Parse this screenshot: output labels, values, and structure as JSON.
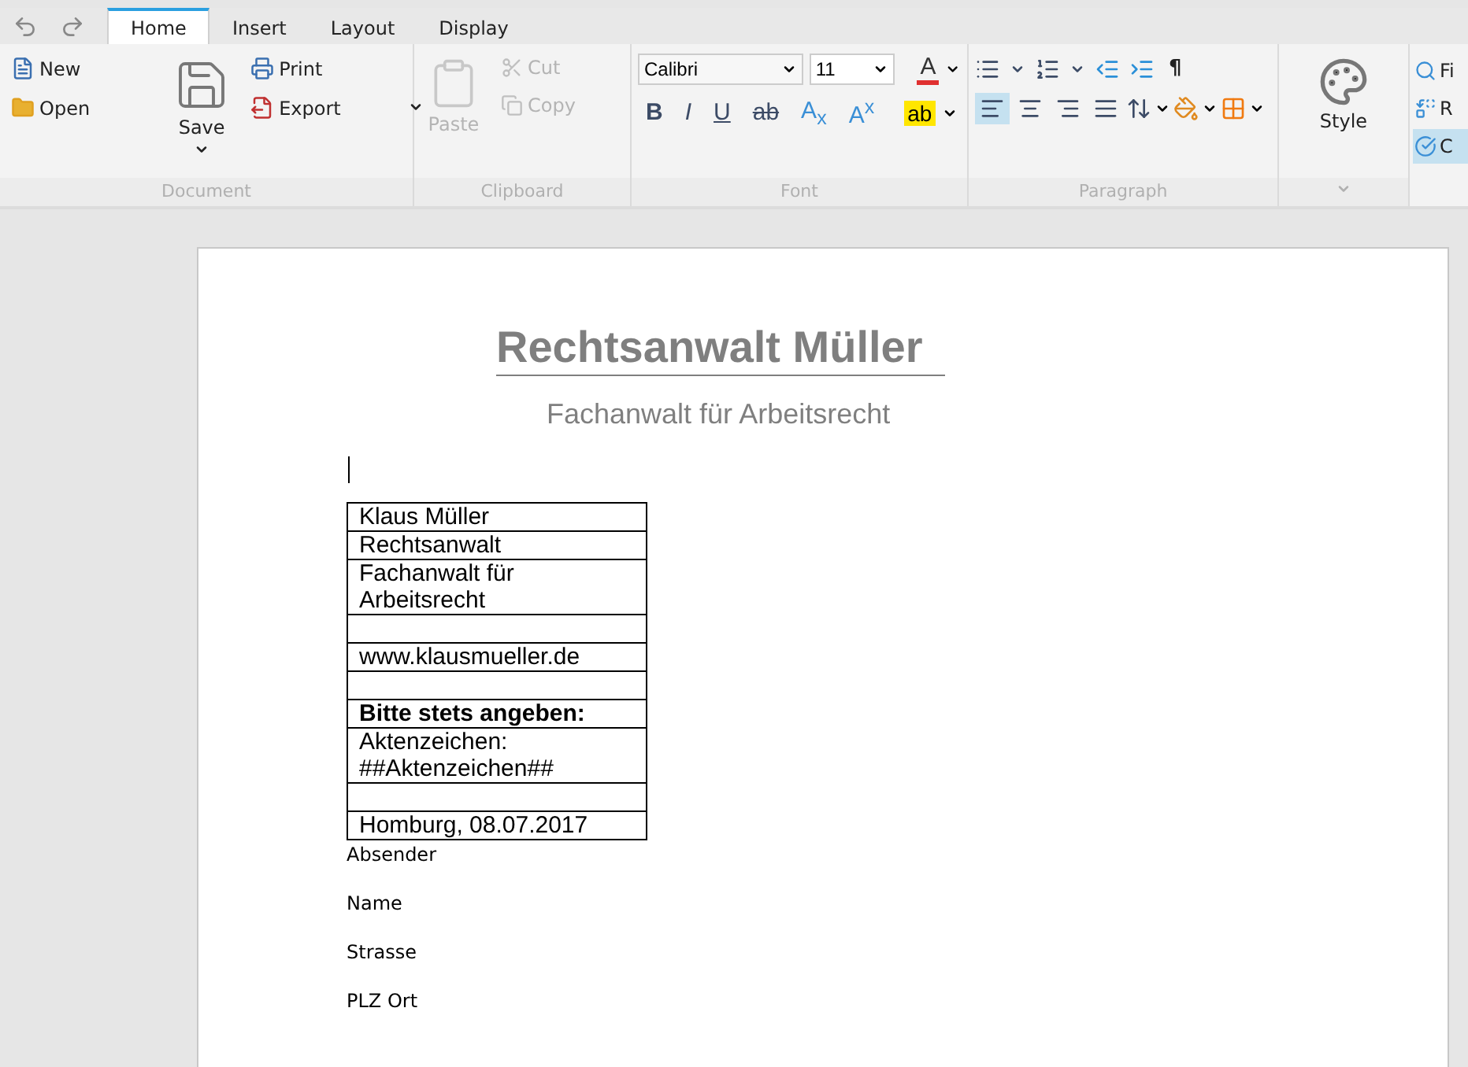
{
  "tabs": [
    {
      "label": "Home",
      "selected": true
    },
    {
      "label": "Insert",
      "selected": false
    },
    {
      "label": "Layout",
      "selected": false
    },
    {
      "label": "Display",
      "selected": false
    }
  ],
  "ribbon": {
    "document": {
      "label": "Document",
      "new": "New",
      "open": "Open",
      "save": "Save",
      "print": "Print",
      "export": "Export"
    },
    "clipboard": {
      "label": "Clipboard",
      "disabled": true,
      "paste": "Paste",
      "cut": "Cut",
      "copy": "Copy"
    },
    "font": {
      "label": "Font",
      "font_name": "Calibri",
      "font_size": "11",
      "color_letter": "A",
      "format_buttons": [
        {
          "kind": "bold",
          "label": "B"
        },
        {
          "kind": "italic",
          "label": "I"
        },
        {
          "kind": "underline",
          "label": "U"
        },
        {
          "kind": "strike",
          "label": "ab"
        },
        {
          "kind": "sub",
          "label": "A$_{x}$"
        },
        {
          "kind": "sup",
          "label": "A$^{x}$"
        }
      ],
      "highlight": "ab"
    },
    "paragraph": {
      "label": "Paragraph",
      "pilcrow": "¶",
      "alignments": [
        {
          "kind": "left",
          "selected": true
        },
        {
          "kind": "center",
          "selected": false
        },
        {
          "kind": "right",
          "selected": false
        },
        {
          "kind": "justify",
          "selected": false
        }
      ]
    },
    "styles": {
      "style": "Style"
    },
    "editing": {
      "items": [
        {
          "kind": "find",
          "label": "Fi",
          "selected": false
        },
        {
          "kind": "replace",
          "label": "R",
          "selected": false
        },
        {
          "kind": "spell",
          "label": "C",
          "selected": true
        }
      ]
    }
  },
  "document": {
    "title": "Rechtsanwalt Müller",
    "subtitle": "Fachanwalt für Arbeitsrecht",
    "table": [
      {
        "kind": "text",
        "text": "Klaus Müller"
      },
      {
        "kind": "text",
        "text": "Rechtsanwalt"
      },
      {
        "kind": "text",
        "text": "Fachanwalt für Arbeitsrecht"
      },
      {
        "kind": "blank"
      },
      {
        "kind": "text",
        "text": "www.klausmueller.de"
      },
      {
        "kind": "blank"
      },
      {
        "kind": "heading",
        "text": "Bitte stets angeben:"
      },
      {
        "kind": "text",
        "text": "Aktenzeichen: ##Aktenzeichen##"
      },
      {
        "kind": "blank"
      },
      {
        "kind": "text",
        "text": "Homburg, 08.07.2017"
      }
    ],
    "address": [
      "Absender",
      "Name",
      "Strasse",
      "PLZ Ort"
    ]
  }
}
